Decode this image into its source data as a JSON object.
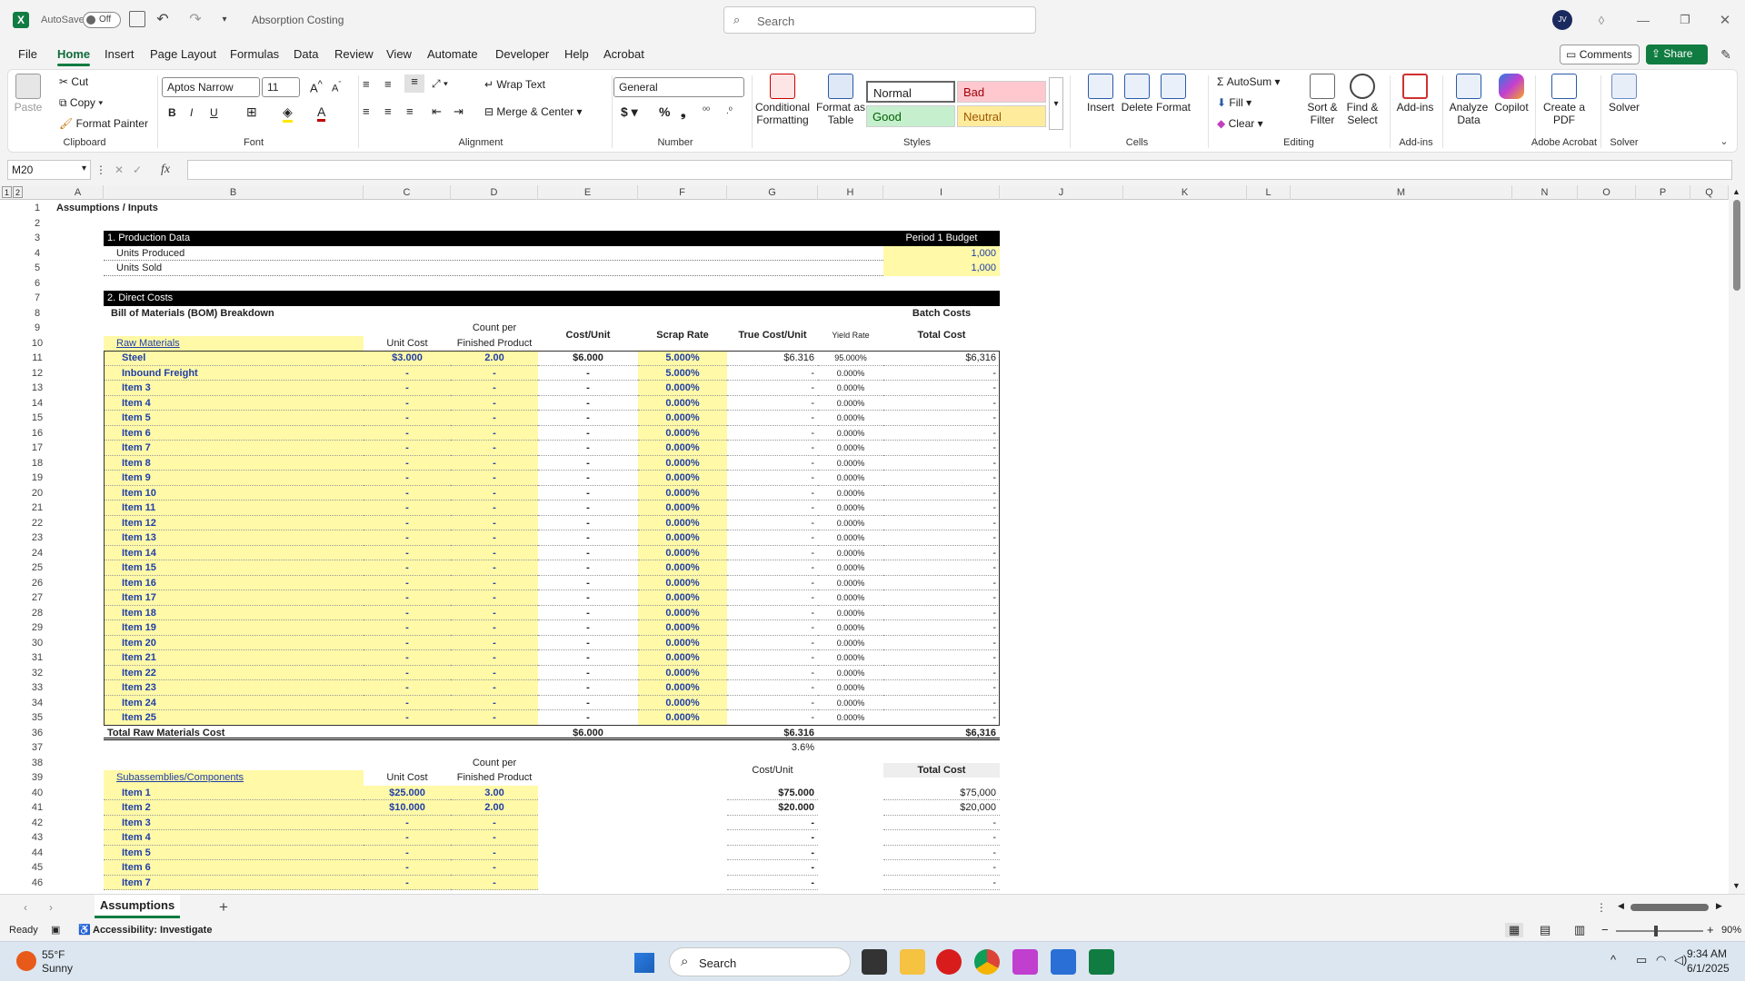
{
  "titlebar": {
    "autosave_label": "AutoSave",
    "autosave_state": "Off",
    "doc_title": "Absorption Costing",
    "search_placeholder": "Search",
    "user_initials": "JV"
  },
  "menu": [
    "File",
    "Home",
    "Insert",
    "Page Layout",
    "Formulas",
    "Data",
    "Review",
    "View",
    "Automate",
    "Developer",
    "Help",
    "Acrobat"
  ],
  "menu_active": "Home",
  "comments_label": "Comments",
  "share_label": "Share",
  "ribbon": {
    "clipboard": {
      "paste": "Paste",
      "cut": "Cut",
      "copy": "Copy",
      "format_painter": "Format Painter",
      "group": "Clipboard"
    },
    "font": {
      "name": "Aptos Narrow",
      "size": "11",
      "group": "Font"
    },
    "alignment": {
      "wrap": "Wrap Text",
      "merge": "Merge & Center",
      "group": "Alignment"
    },
    "number": {
      "format": "General",
      "group": "Number"
    },
    "styles": {
      "conditional": "Conditional Formatting",
      "format_table": "Format as Table",
      "normal": "Normal",
      "bad": "Bad",
      "good": "Good",
      "neutral": "Neutral",
      "group": "Styles"
    },
    "cells": {
      "insert": "Insert",
      "delete": "Delete",
      "format": "Format",
      "group": "Cells"
    },
    "editing": {
      "autosum": "AutoSum",
      "fill": "Fill",
      "clear": "Clear",
      "sort": "Sort & Filter",
      "find": "Find & Select",
      "group": "Editing"
    },
    "addins": {
      "addins": "Add-ins",
      "group": "Add-ins"
    },
    "analyze": "Analyze Data",
    "copilot": "Copilot",
    "acrobat": {
      "create": "Create a PDF",
      "group": "Adobe Acrobat"
    },
    "solver": {
      "solver": "Solver",
      "group": "Solver"
    }
  },
  "namebox": "M20",
  "fx": "fx",
  "columns": [
    "A",
    "B",
    "C",
    "D",
    "E",
    "F",
    "G",
    "H",
    "I",
    "J",
    "K",
    "L",
    "M",
    "N",
    "O",
    "P",
    "Q"
  ],
  "sheet": {
    "title": "Assumptions / Inputs",
    "sec1": "1. Production Data",
    "period": "Period 1 Budget",
    "units_produced": "Units Produced",
    "units_produced_val": "1,000",
    "units_sold": "Units Sold",
    "units_sold_val": "1,000",
    "sec2": "2. Direct Costs",
    "bom": "Bill of Materials (BOM) Breakdown",
    "batch_costs": "Batch Costs",
    "hdr_count": "Count per",
    "hdr_finished": "Finished Product",
    "hdr_costunit": "Cost/Unit",
    "hdr_scrap": "Scrap Rate",
    "hdr_true": "True Cost/Unit",
    "hdr_yield": "Yield Rate",
    "hdr_total": "Total Cost",
    "raw_materials": "Raw Materials",
    "hdr_unitcost": "Unit Cost",
    "raw_rows": [
      {
        "name": "Steel",
        "unit": "$3.000",
        "count": "2.00",
        "cost": "$6.000",
        "scrap": "5.000%",
        "true": "$6.316",
        "yield": "95.000%",
        "total": "$6,316"
      },
      {
        "name": "Inbound Freight",
        "unit": "-",
        "count": "-",
        "cost": "-",
        "scrap": "5.000%",
        "true": "-",
        "yield": "0.000%",
        "total": "-"
      },
      {
        "name": "Item 3",
        "unit": "-",
        "count": "-",
        "cost": "-",
        "scrap": "0.000%",
        "true": "-",
        "yield": "0.000%",
        "total": "-"
      },
      {
        "name": "Item 4",
        "unit": "-",
        "count": "-",
        "cost": "-",
        "scrap": "0.000%",
        "true": "-",
        "yield": "0.000%",
        "total": "-"
      },
      {
        "name": "Item 5",
        "unit": "-",
        "count": "-",
        "cost": "-",
        "scrap": "0.000%",
        "true": "-",
        "yield": "0.000%",
        "total": "-"
      },
      {
        "name": "Item 6",
        "unit": "-",
        "count": "-",
        "cost": "-",
        "scrap": "0.000%",
        "true": "-",
        "yield": "0.000%",
        "total": "-"
      },
      {
        "name": "Item 7",
        "unit": "-",
        "count": "-",
        "cost": "-",
        "scrap": "0.000%",
        "true": "-",
        "yield": "0.000%",
        "total": "-"
      },
      {
        "name": "Item 8",
        "unit": "-",
        "count": "-",
        "cost": "-",
        "scrap": "0.000%",
        "true": "-",
        "yield": "0.000%",
        "total": "-"
      },
      {
        "name": "Item 9",
        "unit": "-",
        "count": "-",
        "cost": "-",
        "scrap": "0.000%",
        "true": "-",
        "yield": "0.000%",
        "total": "-"
      },
      {
        "name": "Item 10",
        "unit": "-",
        "count": "-",
        "cost": "-",
        "scrap": "0.000%",
        "true": "-",
        "yield": "0.000%",
        "total": "-"
      },
      {
        "name": "Item 11",
        "unit": "-",
        "count": "-",
        "cost": "-",
        "scrap": "0.000%",
        "true": "-",
        "yield": "0.000%",
        "total": "-"
      },
      {
        "name": "Item 12",
        "unit": "-",
        "count": "-",
        "cost": "-",
        "scrap": "0.000%",
        "true": "-",
        "yield": "0.000%",
        "total": "-"
      },
      {
        "name": "Item 13",
        "unit": "-",
        "count": "-",
        "cost": "-",
        "scrap": "0.000%",
        "true": "-",
        "yield": "0.000%",
        "total": "-"
      },
      {
        "name": "Item 14",
        "unit": "-",
        "count": "-",
        "cost": "-",
        "scrap": "0.000%",
        "true": "-",
        "yield": "0.000%",
        "total": "-"
      },
      {
        "name": "Item 15",
        "unit": "-",
        "count": "-",
        "cost": "-",
        "scrap": "0.000%",
        "true": "-",
        "yield": "0.000%",
        "total": "-"
      },
      {
        "name": "Item 16",
        "unit": "-",
        "count": "-",
        "cost": "-",
        "scrap": "0.000%",
        "true": "-",
        "yield": "0.000%",
        "total": "-"
      },
      {
        "name": "Item 17",
        "unit": "-",
        "count": "-",
        "cost": "-",
        "scrap": "0.000%",
        "true": "-",
        "yield": "0.000%",
        "total": "-"
      },
      {
        "name": "Item 18",
        "unit": "-",
        "count": "-",
        "cost": "-",
        "scrap": "0.000%",
        "true": "-",
        "yield": "0.000%",
        "total": "-"
      },
      {
        "name": "Item 19",
        "unit": "-",
        "count": "-",
        "cost": "-",
        "scrap": "0.000%",
        "true": "-",
        "yield": "0.000%",
        "total": "-"
      },
      {
        "name": "Item 20",
        "unit": "-",
        "count": "-",
        "cost": "-",
        "scrap": "0.000%",
        "true": "-",
        "yield": "0.000%",
        "total": "-"
      },
      {
        "name": "Item 21",
        "unit": "-",
        "count": "-",
        "cost": "-",
        "scrap": "0.000%",
        "true": "-",
        "yield": "0.000%",
        "total": "-"
      },
      {
        "name": "Item 22",
        "unit": "-",
        "count": "-",
        "cost": "-",
        "scrap": "0.000%",
        "true": "-",
        "yield": "0.000%",
        "total": "-"
      },
      {
        "name": "Item 23",
        "unit": "-",
        "count": "-",
        "cost": "-",
        "scrap": "0.000%",
        "true": "-",
        "yield": "0.000%",
        "total": "-"
      },
      {
        "name": "Item 24",
        "unit": "-",
        "count": "-",
        "cost": "-",
        "scrap": "0.000%",
        "true": "-",
        "yield": "0.000%",
        "total": "-"
      },
      {
        "name": "Item 25",
        "unit": "-",
        "count": "-",
        "cost": "-",
        "scrap": "0.000%",
        "true": "-",
        "yield": "0.000%",
        "total": "-"
      }
    ],
    "total_raw": "Total Raw Materials Cost",
    "total_raw_cost": "$6.000",
    "total_raw_true": "$6.316",
    "total_raw_total": "$6,316",
    "pct_row": "3.6%",
    "subassemblies": "Subassemblies/Components",
    "sub_rows": [
      {
        "name": "Item 1",
        "unit": "$25.000",
        "count": "3.00",
        "cost": "$75.000",
        "total": "$75,000"
      },
      {
        "name": "Item 2",
        "unit": "$10.000",
        "count": "2.00",
        "cost": "$20.000",
        "total": "$20,000"
      },
      {
        "name": "Item 3",
        "unit": "-",
        "count": "-",
        "cost": "-",
        "total": "-"
      },
      {
        "name": "Item 4",
        "unit": "-",
        "count": "-",
        "cost": "-",
        "total": "-"
      },
      {
        "name": "Item 5",
        "unit": "-",
        "count": "-",
        "cost": "-",
        "total": "-"
      },
      {
        "name": "Item 6",
        "unit": "-",
        "count": "-",
        "cost": "-",
        "total": "-"
      },
      {
        "name": "Item 7",
        "unit": "-",
        "count": "-",
        "cost": "-",
        "total": "-"
      }
    ]
  },
  "sheet_tab": "Assumptions",
  "status": {
    "ready": "Ready",
    "accessibility": "Accessibility: Investigate",
    "zoom": "90%"
  },
  "taskbar": {
    "temp": "55°F",
    "weather": "Sunny",
    "search": "Search",
    "time": "9:34 AM",
    "date": "6/1/2025"
  }
}
